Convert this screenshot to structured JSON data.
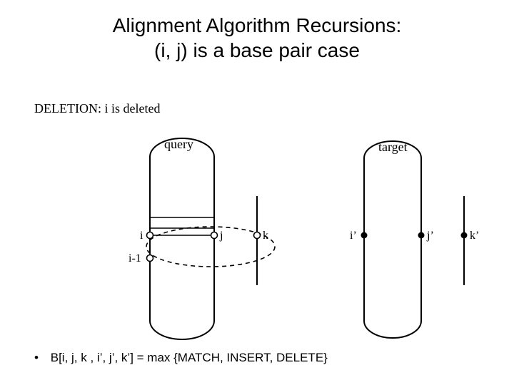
{
  "title_line1": "Alignment Algorithm Recursions:",
  "title_line2": "(i, j) is a base pair case",
  "subhead": "DELETION: i is deleted",
  "labels": {
    "query": "query",
    "target": "target",
    "i": "i",
    "i_minus_1": "i-1",
    "j": "j",
    "k": "k",
    "i_prime": "i’",
    "j_prime": "j’",
    "k_prime": "k’"
  },
  "footer": "B[i, j, k , i’, j’, k’] = max {MATCH, INSERT, DELETE}",
  "geom": {
    "query": {
      "leftX": 210,
      "rightX": 300,
      "extraX": 360,
      "topY": 220,
      "botY": 450,
      "iY": 330,
      "iM1Y": 362
    },
    "target": {
      "leftX": 510,
      "rightX": 590,
      "extraX": 650,
      "topY": 222,
      "botY": 450,
      "rowY": 330
    }
  }
}
